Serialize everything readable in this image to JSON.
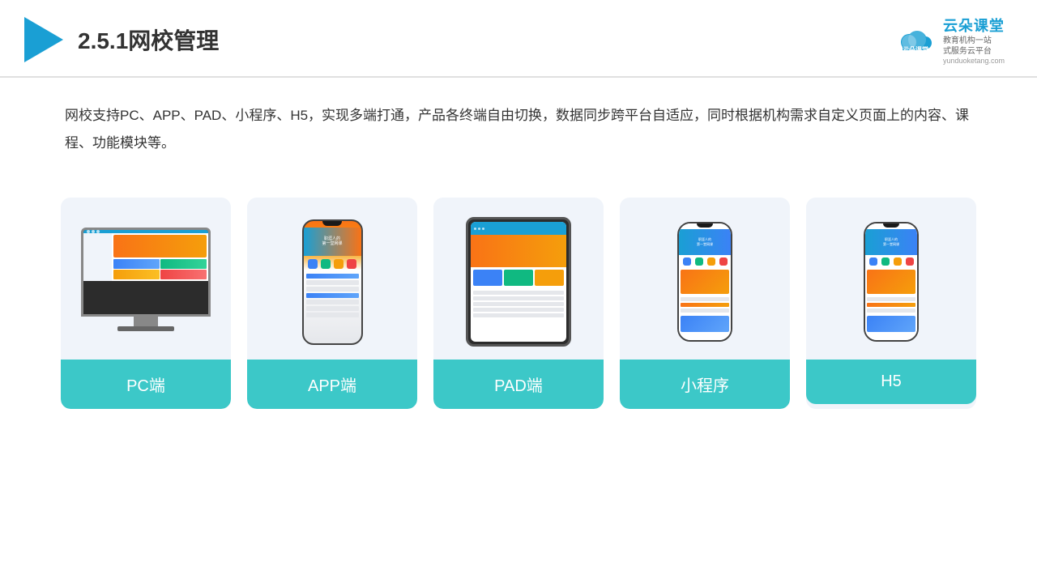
{
  "header": {
    "title": "2.5.1网校管理",
    "brand": {
      "name": "云朵课堂",
      "url": "yunduoketang.com",
      "tagline": "教育机构一站\n式服务云平台"
    }
  },
  "description": {
    "text": "网校支持PC、APP、PAD、小程序、H5，实现多端打通，产品各终端自由切换，数据同步跨平台自适应，同时根据机构需求自定义页面上的内容、课程、功能模块等。"
  },
  "cards": [
    {
      "id": "pc",
      "label": "PC端"
    },
    {
      "id": "app",
      "label": "APP端"
    },
    {
      "id": "pad",
      "label": "PAD端"
    },
    {
      "id": "miniprogram",
      "label": "小程序"
    },
    {
      "id": "h5",
      "label": "H5"
    }
  ]
}
